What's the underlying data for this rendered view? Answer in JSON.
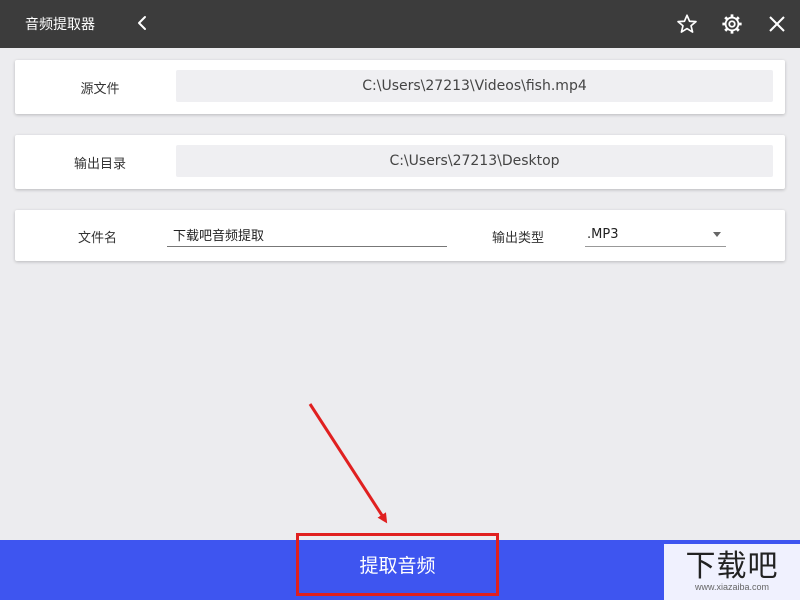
{
  "window": {
    "title": "音频提取器",
    "icons": [
      "back-icon",
      "star-icon",
      "gear-icon",
      "close-icon"
    ]
  },
  "source": {
    "label": "源文件",
    "value": "C:\\Users\\27213\\Videos\\fish.mp4"
  },
  "output_dir": {
    "label": "输出目录",
    "value": "C:\\Users\\27213\\Desktop"
  },
  "options": {
    "filename_label": "文件名",
    "filename_value": "下载吧音频提取",
    "type_label": "输出类型",
    "type_value": ".MP3"
  },
  "action": {
    "extract_label": "提取音频"
  },
  "annotation": {
    "arrow_color": "#e02020",
    "highlight_color": "#e02020"
  },
  "watermark": {
    "logo": "下载吧",
    "url": "www.xiazaiba.com"
  },
  "colors": {
    "titlebar": "#3c3c3c",
    "accent": "#3e55f0",
    "background": "#ececef"
  }
}
